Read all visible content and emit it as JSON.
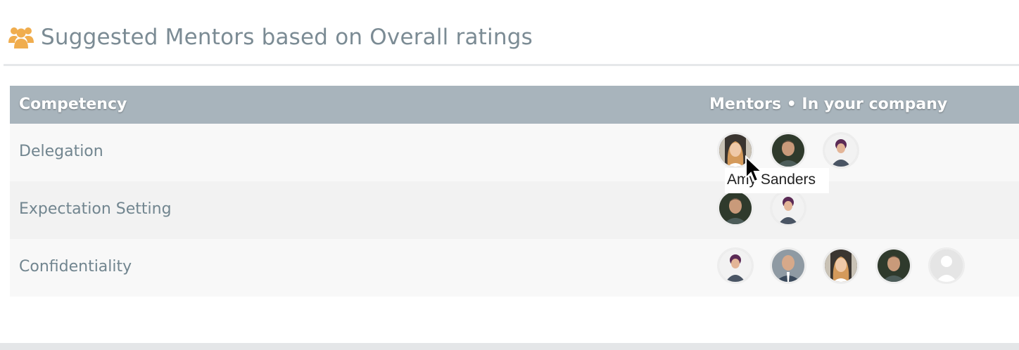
{
  "header": {
    "title": "Suggested Mentors based on Overall ratings",
    "icon": "users-icon",
    "icon_color": "#f0ad4e"
  },
  "table": {
    "columns": [
      "Competency",
      "Mentors • In your company"
    ],
    "rows": [
      {
        "competency": "Delegation",
        "mentors": [
          "woman-blonde",
          "man-beard",
          "woman-purple"
        ]
      },
      {
        "competency": "Expectation Setting",
        "mentors": [
          "man-beard",
          "woman-purple"
        ]
      },
      {
        "competency": "Confidentiality",
        "mentors": [
          "woman-purple",
          "man-bald",
          "woman-blonde",
          "man-beard",
          "placeholder"
        ]
      }
    ]
  },
  "tooltip": {
    "text": "Amy Sanders"
  },
  "colors": {
    "header_bg": "#a8b4bc",
    "text_muted": "#71858f",
    "title": "#7b8b94"
  }
}
